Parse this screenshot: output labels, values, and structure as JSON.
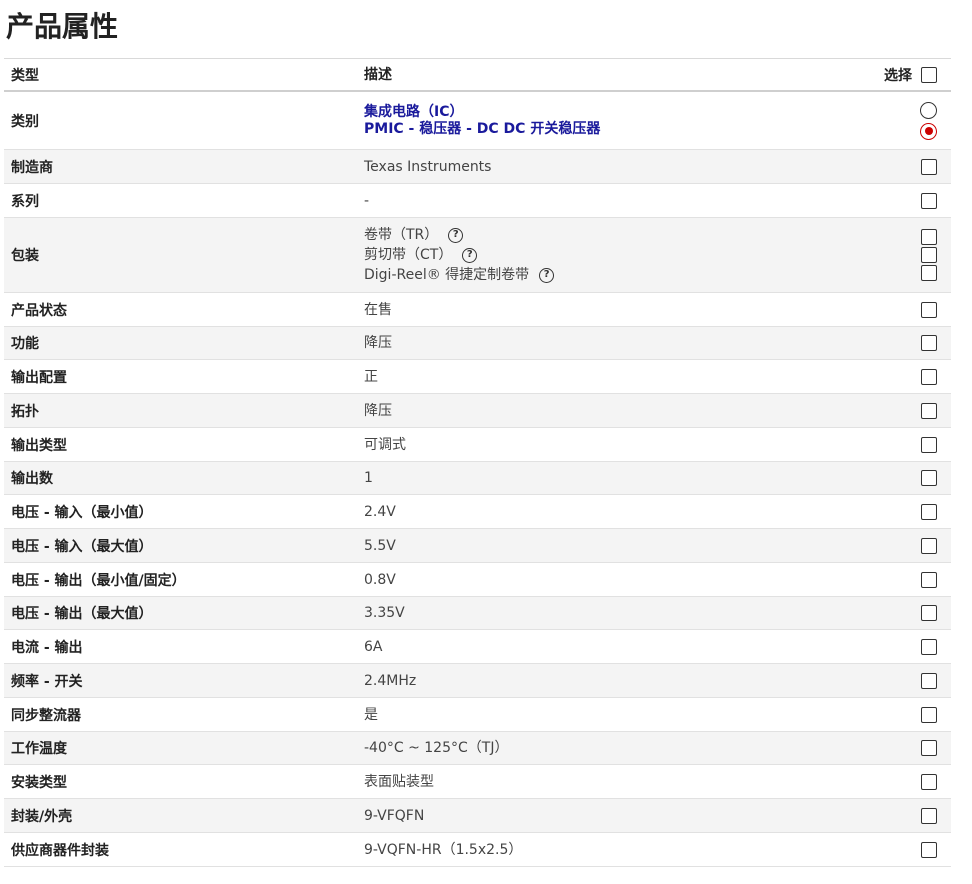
{
  "page": {
    "title": "产品属性"
  },
  "table": {
    "headers": {
      "type": "类型",
      "description": "描述",
      "select": "选择"
    },
    "category": {
      "label": "类别",
      "values": [
        "集成电路（IC）",
        "PMIC - 稳压器 - DC DC 开关稳压器"
      ]
    },
    "manufacturer": {
      "label": "制造商",
      "value": "Texas Instruments"
    },
    "series": {
      "label": "系列",
      "value": "-"
    },
    "packaging": {
      "label": "包装",
      "options": [
        "卷带（TR）",
        "剪切带（CT）",
        "Digi-Reel® 得捷定制卷带"
      ]
    },
    "rows": [
      {
        "label": "产品状态",
        "value": "在售"
      },
      {
        "label": "功能",
        "value": "降压"
      },
      {
        "label": "输出配置",
        "value": "正"
      },
      {
        "label": "拓扑",
        "value": "降压"
      },
      {
        "label": "输出类型",
        "value": "可调式"
      },
      {
        "label": "输出数",
        "value": "1"
      },
      {
        "label": "电压 - 输入（最小值）",
        "value": "2.4V"
      },
      {
        "label": "电压 - 输入（最大值）",
        "value": "5.5V"
      },
      {
        "label": "电压 - 输出（最小值/固定）",
        "value": "0.8V"
      },
      {
        "label": "电压 - 输出（最大值）",
        "value": "3.35V"
      },
      {
        "label": "电流 - 输出",
        "value": "6A"
      },
      {
        "label": "频率 - 开关",
        "value": "2.4MHz"
      },
      {
        "label": "同步整流器",
        "value": "是"
      },
      {
        "label": "工作温度",
        "value": "-40°C ~ 125°C（TJ）"
      },
      {
        "label": "安装类型",
        "value": "表面贴装型"
      },
      {
        "label": "封装/外壳",
        "value": "9-VFQFN"
      },
      {
        "label": "供应商器件封装",
        "value": "9-VQFN-HR（1.5x2.5）"
      }
    ]
  },
  "icons": {
    "help": "question-circle-icon"
  },
  "colors": {
    "link": "#1a1a9c",
    "radio_selected": "#cc0000"
  }
}
